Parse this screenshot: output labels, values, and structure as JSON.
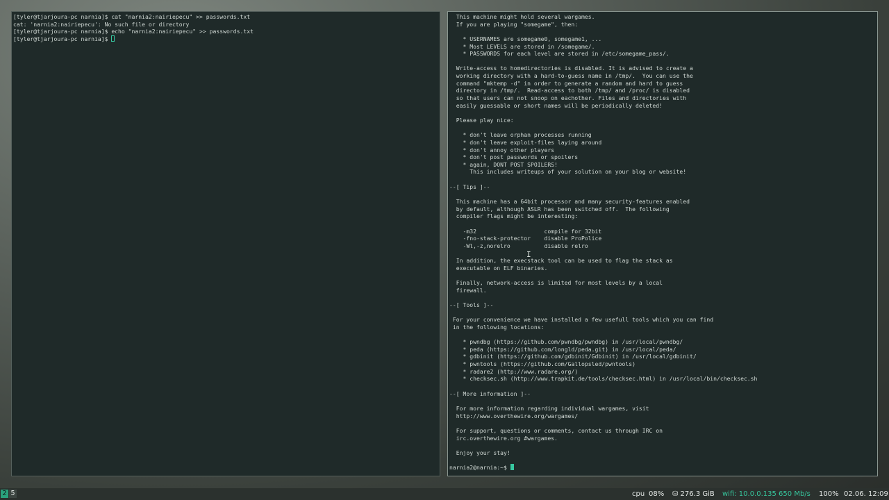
{
  "left_terminal": {
    "lines": [
      "[tyler@tjarjoura-pc narnia]$ cat \"narnia2:nairiepecu\" >> passwords.txt",
      "cat: 'narnia2:nairiepecu': No such file or directory",
      "[tyler@tjarjoura-pc narnia]$ echo \"narnia2:nairiepecu\" >> passwords.txt"
    ],
    "prompt": "[tyler@tjarjoura-pc narnia]$ "
  },
  "right_terminal": {
    "lines": [
      "  This machine might hold several wargames.",
      "  If you are playing \"somegame\", then:",
      "",
      "    * USERNAMES are somegame0, somegame1, ...",
      "    * Most LEVELS are stored in /somegame/.",
      "    * PASSWORDS for each level are stored in /etc/somegame_pass/.",
      "",
      "  Write-access to homedirectories is disabled. It is advised to create a",
      "  working directory with a hard-to-guess name in /tmp/.  You can use the",
      "  command \"mktemp -d\" in order to generate a random and hard to guess",
      "  directory in /tmp/.  Read-access to both /tmp/ and /proc/ is disabled",
      "  so that users can not snoop on eachother. Files and directories with",
      "  easily guessable or short names will be periodically deleted!",
      "",
      "  Please play nice:",
      "",
      "    * don't leave orphan processes running",
      "    * don't leave exploit-files laying around",
      "    * don't annoy other players",
      "    * don't post passwords or spoilers",
      "    * again, DONT POST SPOILERS!",
      "      This includes writeups of your solution on your blog or website!",
      "",
      "--[ Tips ]--",
      "",
      "  This machine has a 64bit processor and many security-features enabled",
      "  by default, although ASLR has been switched off.  The following",
      "  compiler flags might be interesting:",
      "",
      "    -m32                    compile for 32bit",
      "    -fno-stack-protector    disable ProPolice",
      "    -Wl,-z,norelro          disable relro",
      "",
      "  In addition, the execstack tool can be used to flag the stack as",
      "  executable on ELF binaries.",
      "",
      "  Finally, network-access is limited for most levels by a local",
      "  firewall.",
      "",
      "--[ Tools ]--",
      "",
      " For your convenience we have installed a few usefull tools which you can find",
      " in the following locations:",
      "",
      "    * pwndbg (https://github.com/pwndbg/pwndbg) in /usr/local/pwndbg/",
      "    * peda (https://github.com/longld/peda.git) in /usr/local/peda/",
      "    * gdbinit (https://github.com/gdbinit/Gdbinit) in /usr/local/gdbinit/",
      "    * pwntools (https://github.com/Gallopsled/pwntools)",
      "    * radare2 (http://www.radare.org/)",
      "    * checksec.sh (http://www.trapkit.de/tools/checksec.html) in /usr/local/bin/checksec.sh",
      "",
      "--[ More information ]--",
      "",
      "  For more information regarding individual wargames, visit",
      "  http://www.overthewire.org/wargames/",
      "",
      "  For support, questions or comments, contact us through IRC on",
      "  irc.overthewire.org #wargames.",
      "",
      "  Enjoy your stay!",
      ""
    ],
    "prompt": "narnia2@narnia:~$ "
  },
  "taskbar": {
    "workspaces": [
      "2",
      "5"
    ],
    "cpu_label": "cpu",
    "cpu_value": "08%",
    "disk": "⛁ 276.3 GiB",
    "wifi": "wifi: 10.0.0.135 650 Mb/s",
    "volume": "100%",
    "clock": "02.06. 12:09"
  },
  "colors": {
    "accent": "#2aa17d",
    "terminal_bg": "#1f2a29",
    "terminal_fg": "#cfd7d3",
    "cursor": "#37c8a0",
    "wifi": "#36c59c"
  }
}
